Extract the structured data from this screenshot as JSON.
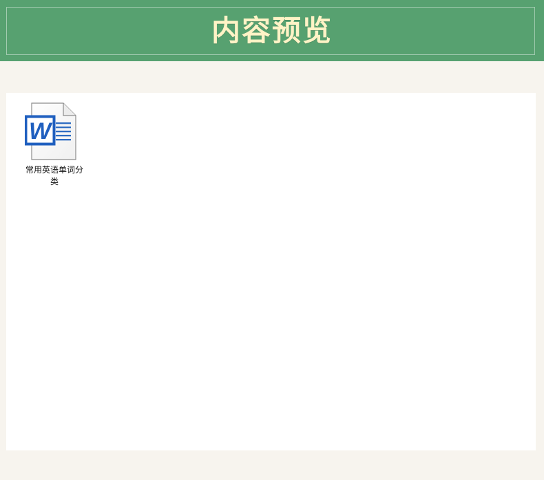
{
  "header": {
    "title": "内容预览"
  },
  "files": [
    {
      "name": "常用英语单词分类",
      "icon": "word-document-icon"
    }
  ],
  "colors": {
    "header_bg": "#57a170",
    "title_text": "#fff3c6",
    "page_bg": "#f7f4ee",
    "panel_bg": "#ffffff",
    "word_blue": "#1f5fbf"
  }
}
